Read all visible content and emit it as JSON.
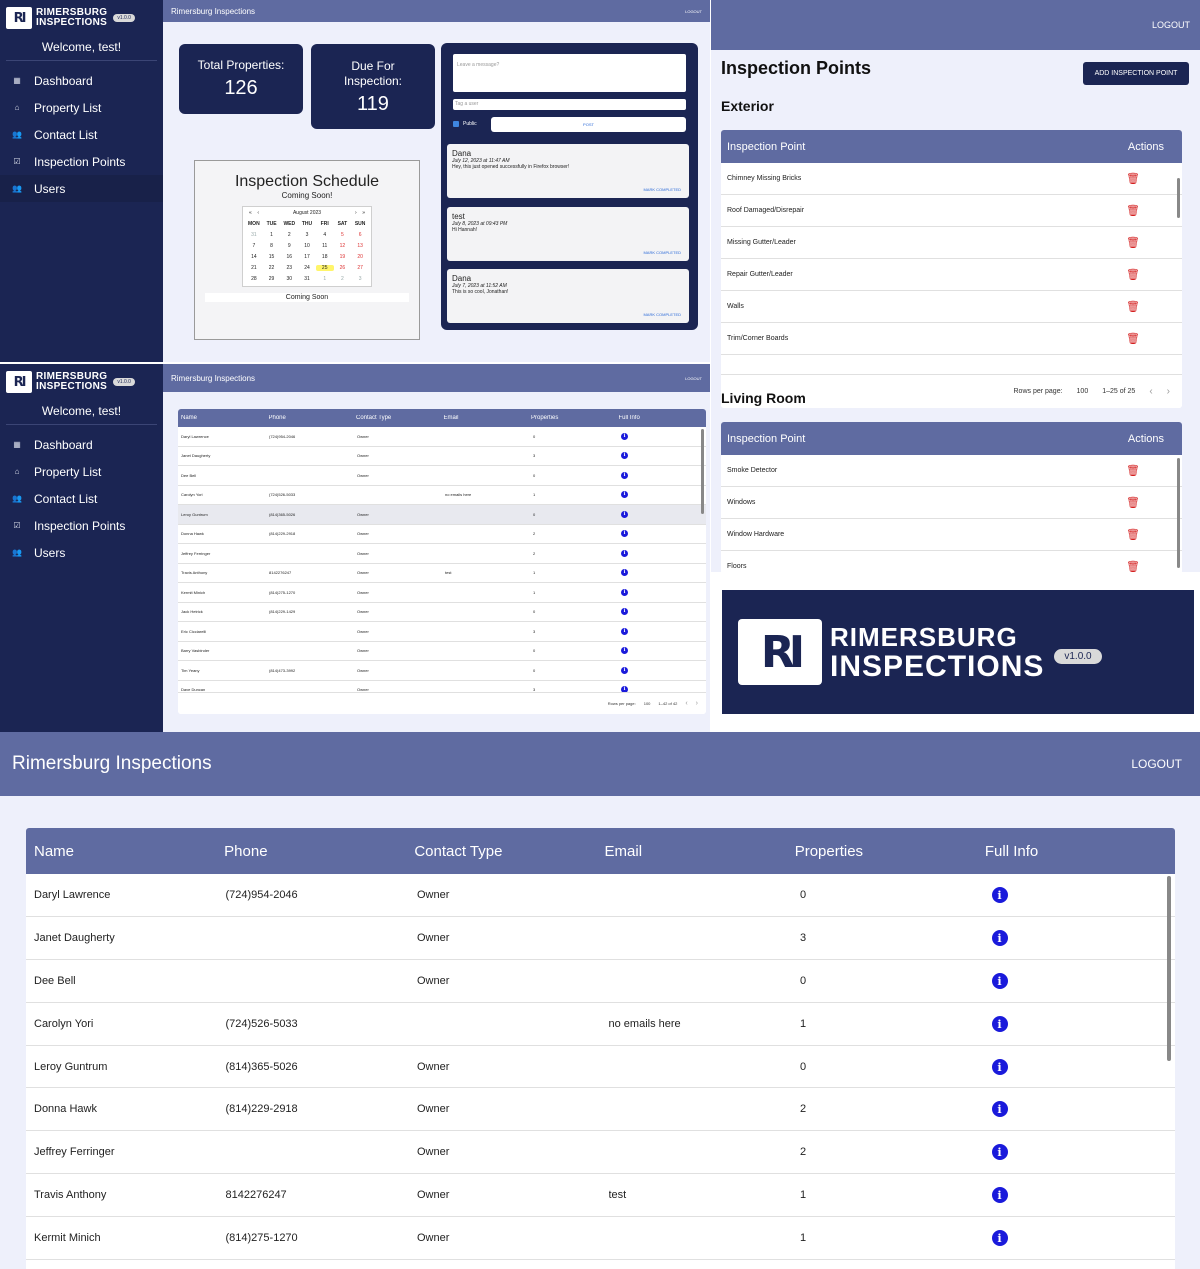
{
  "brand": {
    "line1": "RIMERSBURG",
    "line2": "INSPECTIONS",
    "version": "v1.0.0",
    "mark": "RI"
  },
  "app_title": "Rimersburg Inspections",
  "logout": "LOGOUT",
  "welcome": "Welcome, test!",
  "nav": [
    {
      "label": "Dashboard",
      "icon": "dashboard-icon"
    },
    {
      "label": "Property List",
      "icon": "home-icon"
    },
    {
      "label": "Contact List",
      "icon": "people-icon"
    },
    {
      "label": "Inspection Points",
      "icon": "checkbox-icon"
    },
    {
      "label": "Users",
      "icon": "group-icon"
    }
  ],
  "dashboard": {
    "total_label": "Total Properties:",
    "total_value": "126",
    "due_label": "Due For Inspection:",
    "due_value": "119",
    "schedule_title": "Inspection Schedule",
    "schedule_subtitle": "Coming Soon!",
    "schedule_footer": "Coming Soon",
    "calendar": {
      "month": "August 2023",
      "prev": "‹",
      "prev_year": "«",
      "next": "›",
      "next_year": "»",
      "dows": [
        "MON",
        "TUE",
        "WED",
        "THU",
        "FRI",
        "SAT",
        "SUN"
      ],
      "days": [
        "31",
        "1",
        "2",
        "3",
        "4",
        "5",
        "6",
        "7",
        "8",
        "9",
        "10",
        "11",
        "12",
        "13",
        "14",
        "15",
        "16",
        "17",
        "18",
        "19",
        "20",
        "21",
        "22",
        "23",
        "24",
        "25",
        "26",
        "27",
        "28",
        "29",
        "30",
        "31",
        "1",
        "2",
        "3"
      ],
      "today": "25"
    },
    "message_placeholder": "Leave a message?",
    "tag_placeholder": "Tag a user",
    "public_label": "Public",
    "post_label": "POST",
    "messages": [
      {
        "author": "Dana",
        "date": "July 12, 2023 at 11:47 AM",
        "text": "Hey, this just opened successfully in Firefox browser!",
        "action": "MARK COMPLETED"
      },
      {
        "author": "test",
        "date": "July 8, 2023 at 09:43 PM",
        "text": "Hi Hannah!",
        "action": "MARK COMPLETED"
      },
      {
        "author": "Dana",
        "date": "July 7, 2023 at 11:52 AM",
        "text": "This is so cool, Jonathan!",
        "action": "MARK COMPLETED"
      }
    ]
  },
  "inspection": {
    "title": "Inspection Points",
    "add_button": "ADD INSPECTION POINT",
    "col_point": "Inspection Point",
    "col_actions": "Actions",
    "rows_per_page_label": "Rows per page:",
    "rows_per_page_value": "100",
    "range": "1–25 of 25",
    "sections": [
      {
        "name": "Exterior",
        "points": [
          "Chimney Missing Bricks",
          "Roof Damaged/Disrepair",
          "Missing Gutter/Leader",
          "Repair Gutter/Leader",
          "Walls",
          "Trim/Corner Boards"
        ]
      },
      {
        "name": "Living Room",
        "points": [
          "Smoke Detector",
          "Windows",
          "Window Hardware",
          "Floors"
        ]
      }
    ]
  },
  "contacts": {
    "columns": [
      "Name",
      "Phone",
      "Contact Type",
      "Email",
      "Properties",
      "Full Info"
    ],
    "rows": [
      [
        "Daryl Lawrence",
        "(724)954-2046",
        "Owner",
        "",
        "0"
      ],
      [
        "Janet Daugherty",
        "",
        "Owner",
        "",
        "3"
      ],
      [
        "Dee Bell",
        "",
        "Owner",
        "",
        "0"
      ],
      [
        "Carolyn Yori",
        "(724)526-5033",
        "",
        "no emails here",
        "1"
      ],
      [
        "Leroy Guntrum",
        "(814)365-5026",
        "Owner",
        "",
        "0"
      ],
      [
        "Donna Hawk",
        "(814)229-2918",
        "Owner",
        "",
        "2"
      ],
      [
        "Jeffrey Ferringer",
        "",
        "Owner",
        "",
        "2"
      ],
      [
        "Travis Anthony",
        "8142276247",
        "Owner",
        "test",
        "1"
      ],
      [
        "Kermit Minich",
        "(814)275-1270",
        "Owner",
        "",
        "1"
      ],
      [
        "Jack Hetrick",
        "(814)229-1429",
        "Owner",
        "",
        "0"
      ],
      [
        "Eric Cicciarelli",
        "",
        "Owner",
        "",
        "3"
      ],
      [
        "Barry Vasbinder",
        "",
        "Owner",
        "",
        "0"
      ],
      [
        "Tim Yeany",
        "(814)473-3992",
        "Owner",
        "",
        "0"
      ],
      [
        "Dave Duncan",
        "",
        "Owner",
        "",
        "3"
      ]
    ],
    "rows_per_page_label": "Rows per page:",
    "rows_per_page_value": "100",
    "range": "1–42 of 42"
  },
  "colors": {
    "navy": "#1b2553",
    "topbar": "#5f6ba1",
    "background": "#eef0fb",
    "trash": "#d41f1f",
    "info": "#1a1adb"
  }
}
